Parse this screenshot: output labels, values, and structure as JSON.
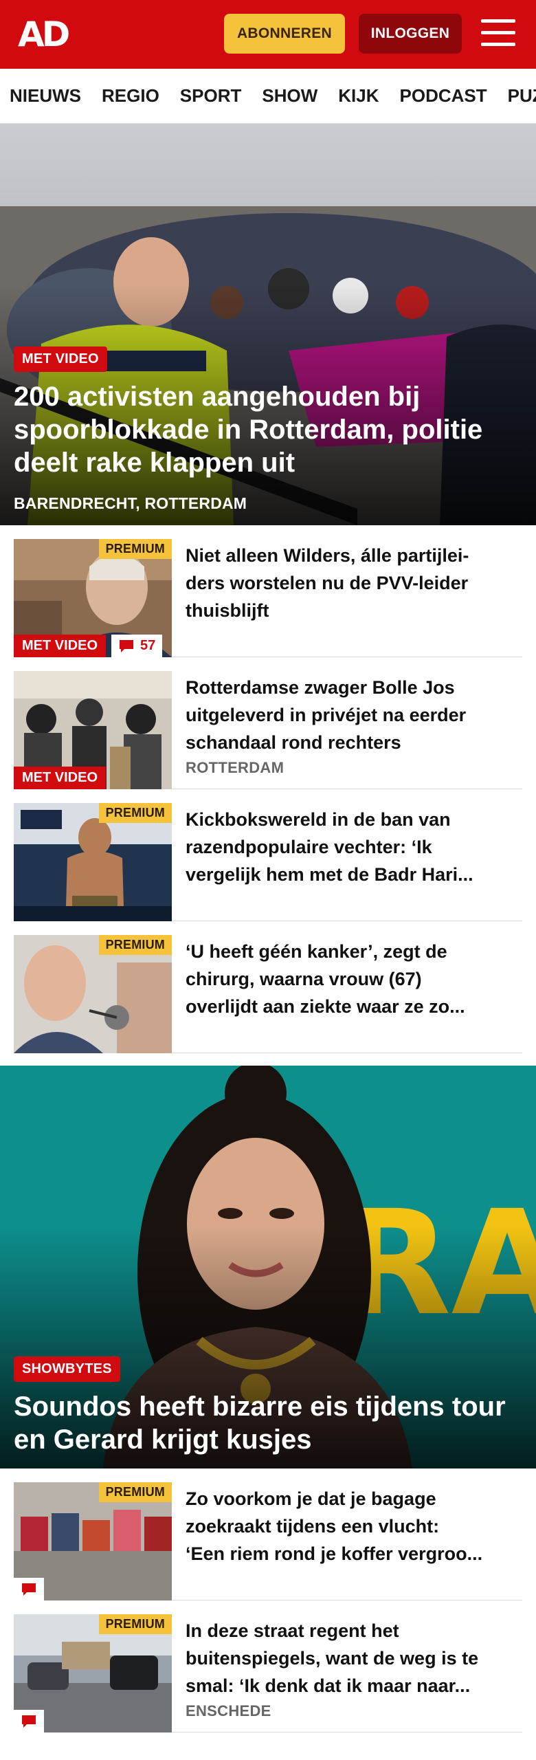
{
  "header": {
    "logo": "AD",
    "subscribe_label": "ABONNEREN",
    "login_label": "INLOGGEN",
    "brand_color": "#d10a10",
    "subscribe_color": "#f5c23b"
  },
  "nav": {
    "items": [
      "NIEUWS",
      "REGIO",
      "SPORT",
      "SHOW",
      "KIJK",
      "PODCAST",
      "PUZZELS"
    ]
  },
  "hero1": {
    "label": "MET VIDEO",
    "title": "200 activisten aangehouden bij spoorblokkade in Rotterdam, politie deelt rake klappen uit",
    "location": "BARENDRECHT, ROTTERDAM"
  },
  "articles": [
    {
      "title_lines": [
        "Niet alleen Wilders, álle partijlei-",
        "ders worstelen nu de PVV-leider",
        "thuisblijft"
      ],
      "premium": "PREMIUM",
      "video_label": "MET VIDEO",
      "comments": "57",
      "location": ""
    },
    {
      "title_lines": [
        "Rotterdamse zwager Bolle Jos",
        "uitgeleverd in privéjet na eerder",
        "schandaal rond rechters"
      ],
      "premium": "",
      "video_label": "MET VIDEO",
      "comments": "",
      "location": "ROTTERDAM"
    },
    {
      "title_lines": [
        "Kickbokswereld in de ban van",
        "razendpopulaire vechter: ‘Ik",
        "vergelijk hem met de Badr Hari..."
      ],
      "premium": "PREMIUM",
      "video_label": "",
      "comments": "",
      "location": ""
    },
    {
      "title_lines": [
        "‘U heeft géén kanker’, zegt de",
        "chirurg, waarna vrouw (67)",
        "overlijdt aan ziekte waar ze zo..."
      ],
      "premium": "PREMIUM",
      "video_label": "",
      "comments": "",
      "location": ""
    }
  ],
  "hero2": {
    "label": "SHOWBYTES",
    "title": "Soundos heeft bizarre eis tijdens tour en Gerard krijgt kusjes",
    "backdrop_text": "RA"
  },
  "articles2": [
    {
      "title_lines": [
        "Zo voorkom je dat je bagage",
        "zoekraakt tijdens een vlucht:",
        "‘Een riem rond je koffer vergroo..."
      ],
      "premium": "PREMIUM",
      "location": ""
    },
    {
      "title_lines": [
        "In deze straat regent het",
        "buitenspiegels, want de weg is te",
        "smal: ‘Ik denk dat ik maar naar..."
      ],
      "premium": "PREMIUM",
      "location": "ENSCHEDE"
    }
  ]
}
